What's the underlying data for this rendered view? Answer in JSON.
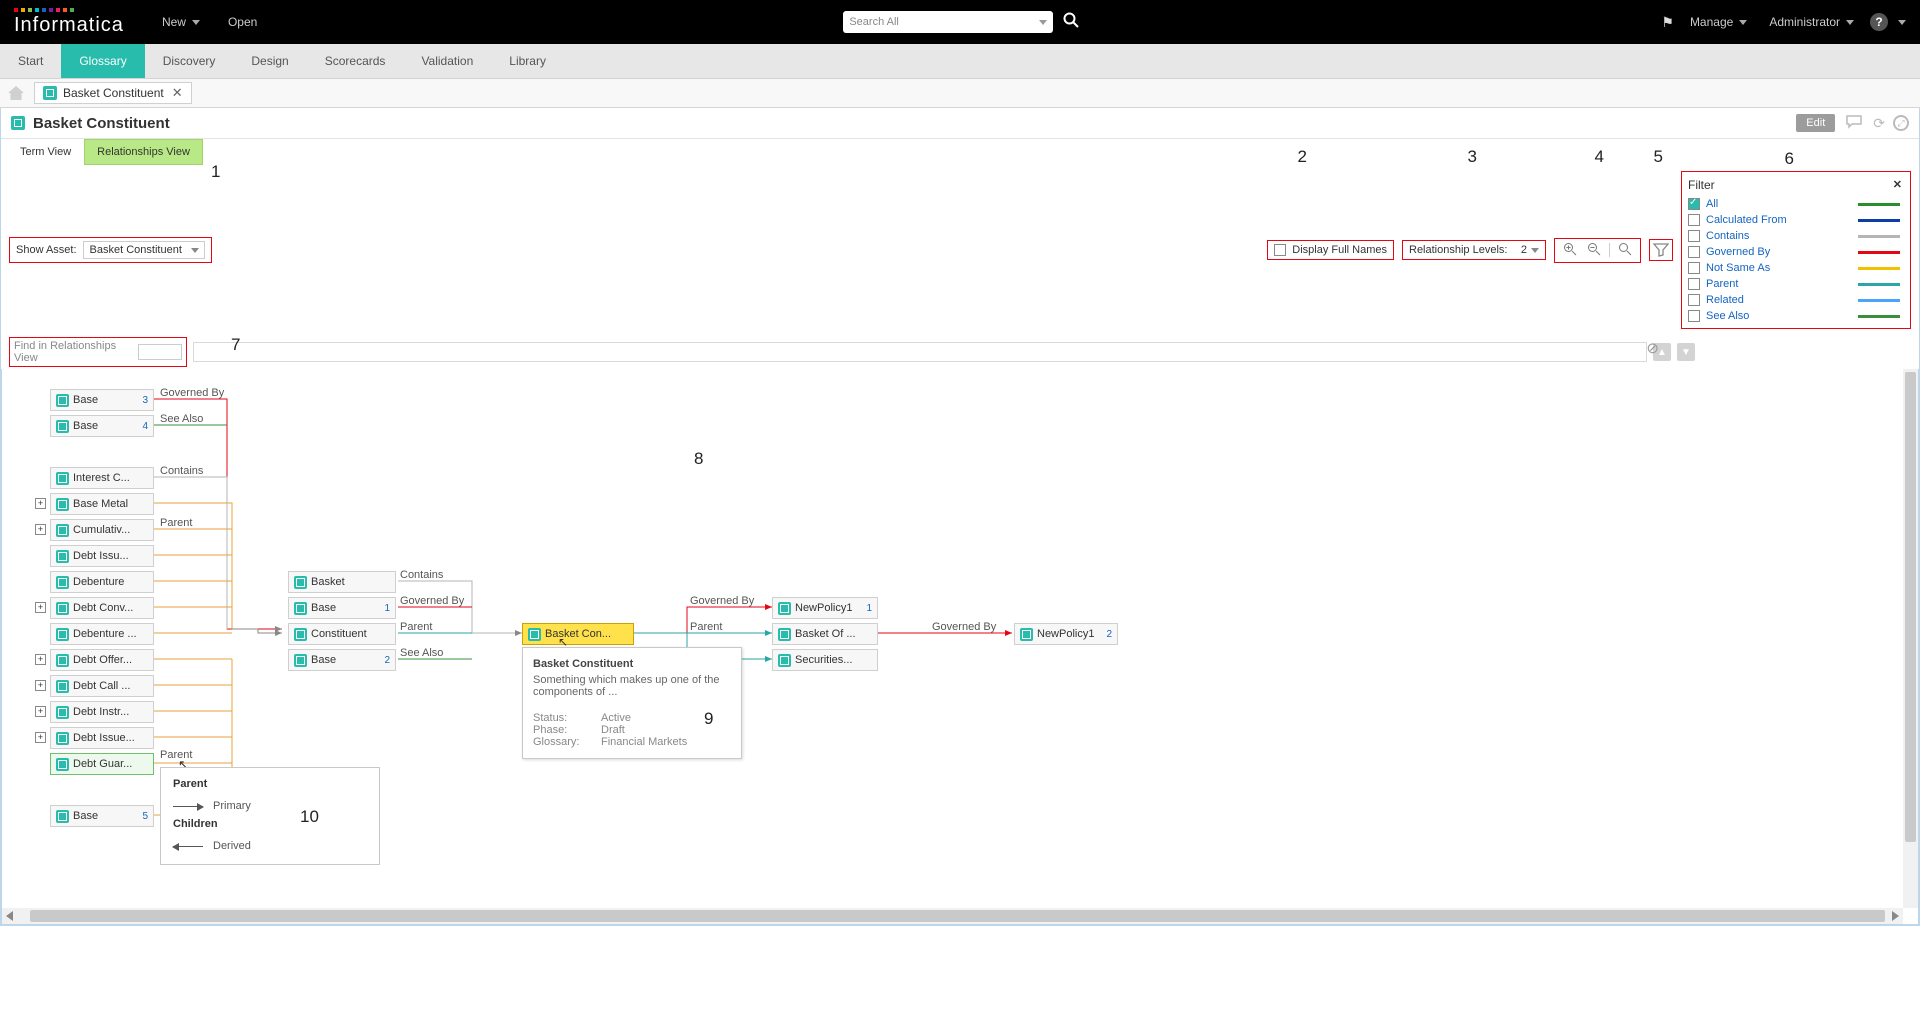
{
  "nav": {
    "new": "New",
    "open": "Open",
    "search_placeholder": "Search All",
    "manage": "Manage",
    "admin": "Administrator"
  },
  "tabs": [
    "Start",
    "Glossary",
    "Discovery",
    "Design",
    "Scorecards",
    "Validation",
    "Library"
  ],
  "active_tab": "Glossary",
  "crumb": {
    "title": "Basket Constituent"
  },
  "page_title": "Basket Constituent",
  "edit": "Edit",
  "subtabs": {
    "term": "Term View",
    "rel": "Relationships View"
  },
  "toolbar": {
    "show_asset": "Show Asset:",
    "asset": "Basket Constituent",
    "display_full": "Display Full Names",
    "rel_levels_lbl": "Relationship Levels:",
    "rel_levels_val": "2"
  },
  "filter": {
    "title": "Filter",
    "items": [
      {
        "label": "All",
        "checked": true,
        "color": "#2a8f2a"
      },
      {
        "label": "Calculated From",
        "checked": false,
        "color": "#0b3ea8"
      },
      {
        "label": "Contains",
        "checked": false,
        "color": "#b5b5b5"
      },
      {
        "label": "Governed By",
        "checked": false,
        "color": "#e30613"
      },
      {
        "label": "Not Same As",
        "checked": false,
        "color": "#f2c200"
      },
      {
        "label": "Parent",
        "checked": false,
        "color": "#2aa6a6"
      },
      {
        "label": "Related",
        "checked": false,
        "color": "#4aa3ff"
      },
      {
        "label": "See Also",
        "checked": false,
        "color": "#3a8f3a"
      }
    ]
  },
  "find_placeholder": "Find in Relationships View",
  "annot": {
    "a1": "1",
    "a2": "2",
    "a3": "3",
    "a4": "4",
    "a5": "5",
    "a6": "6",
    "a7": "7",
    "a8": "8",
    "a9": "9",
    "a10": "10"
  },
  "col1": [
    {
      "label": "Base",
      "count": "3"
    },
    {
      "label": "Base",
      "count": "4"
    }
  ],
  "col1_rel": [
    "Governed By",
    "See Also"
  ],
  "col1b_rel": "Contains",
  "col1b": [
    {
      "label": "Interest C...",
      "exp": false
    },
    {
      "label": "Base Metal",
      "exp": true
    },
    {
      "label": "Cumulativ...",
      "exp": true
    },
    {
      "label": "Debt Issu...",
      "exp": false
    },
    {
      "label": "Debenture",
      "exp": false
    },
    {
      "label": "Debt Conv...",
      "exp": true
    },
    {
      "label": "Debenture ...",
      "exp": false
    },
    {
      "label": "Debt Offer...",
      "exp": true
    },
    {
      "label": "Debt Call ...",
      "exp": true
    },
    {
      "label": "Debt Instr...",
      "exp": true
    },
    {
      "label": "Debt Issue...",
      "exp": true
    },
    {
      "label": "Debt Guar...",
      "exp": false
    }
  ],
  "col1c": {
    "label": "Base",
    "count": "5"
  },
  "parent_lbl": "Parent",
  "parent_lbl2": "Parent",
  "col2_rel": [
    "Contains",
    "Governed By",
    "Parent",
    "See Also"
  ],
  "col2": [
    {
      "label": "Basket"
    },
    {
      "label": "Base",
      "count": "1"
    },
    {
      "label": "Constituent"
    },
    {
      "label": "Base",
      "count": "2"
    }
  ],
  "center": {
    "label": "Basket Con..."
  },
  "col3_rel": [
    "Governed By",
    "Parent"
  ],
  "col3": [
    {
      "label": "NewPolicy1",
      "count": "1"
    },
    {
      "label": "Basket Of ..."
    },
    {
      "label": "Securities..."
    }
  ],
  "col4_rel": "Governed By",
  "col4": [
    {
      "label": "NewPolicy1",
      "count": "2"
    }
  ],
  "tooltip": {
    "title": "Basket Constituent",
    "desc": "Something which makes up one of the components of ...",
    "status_k": "Status:",
    "status_v": "Active",
    "phase_k": "Phase:",
    "phase_v": "Draft",
    "gloss_k": "Glossary:",
    "gloss_v": "Financial Markets"
  },
  "legend": {
    "parent": "Parent",
    "children": "Children",
    "primary": "Primary",
    "derived": "Derived"
  }
}
